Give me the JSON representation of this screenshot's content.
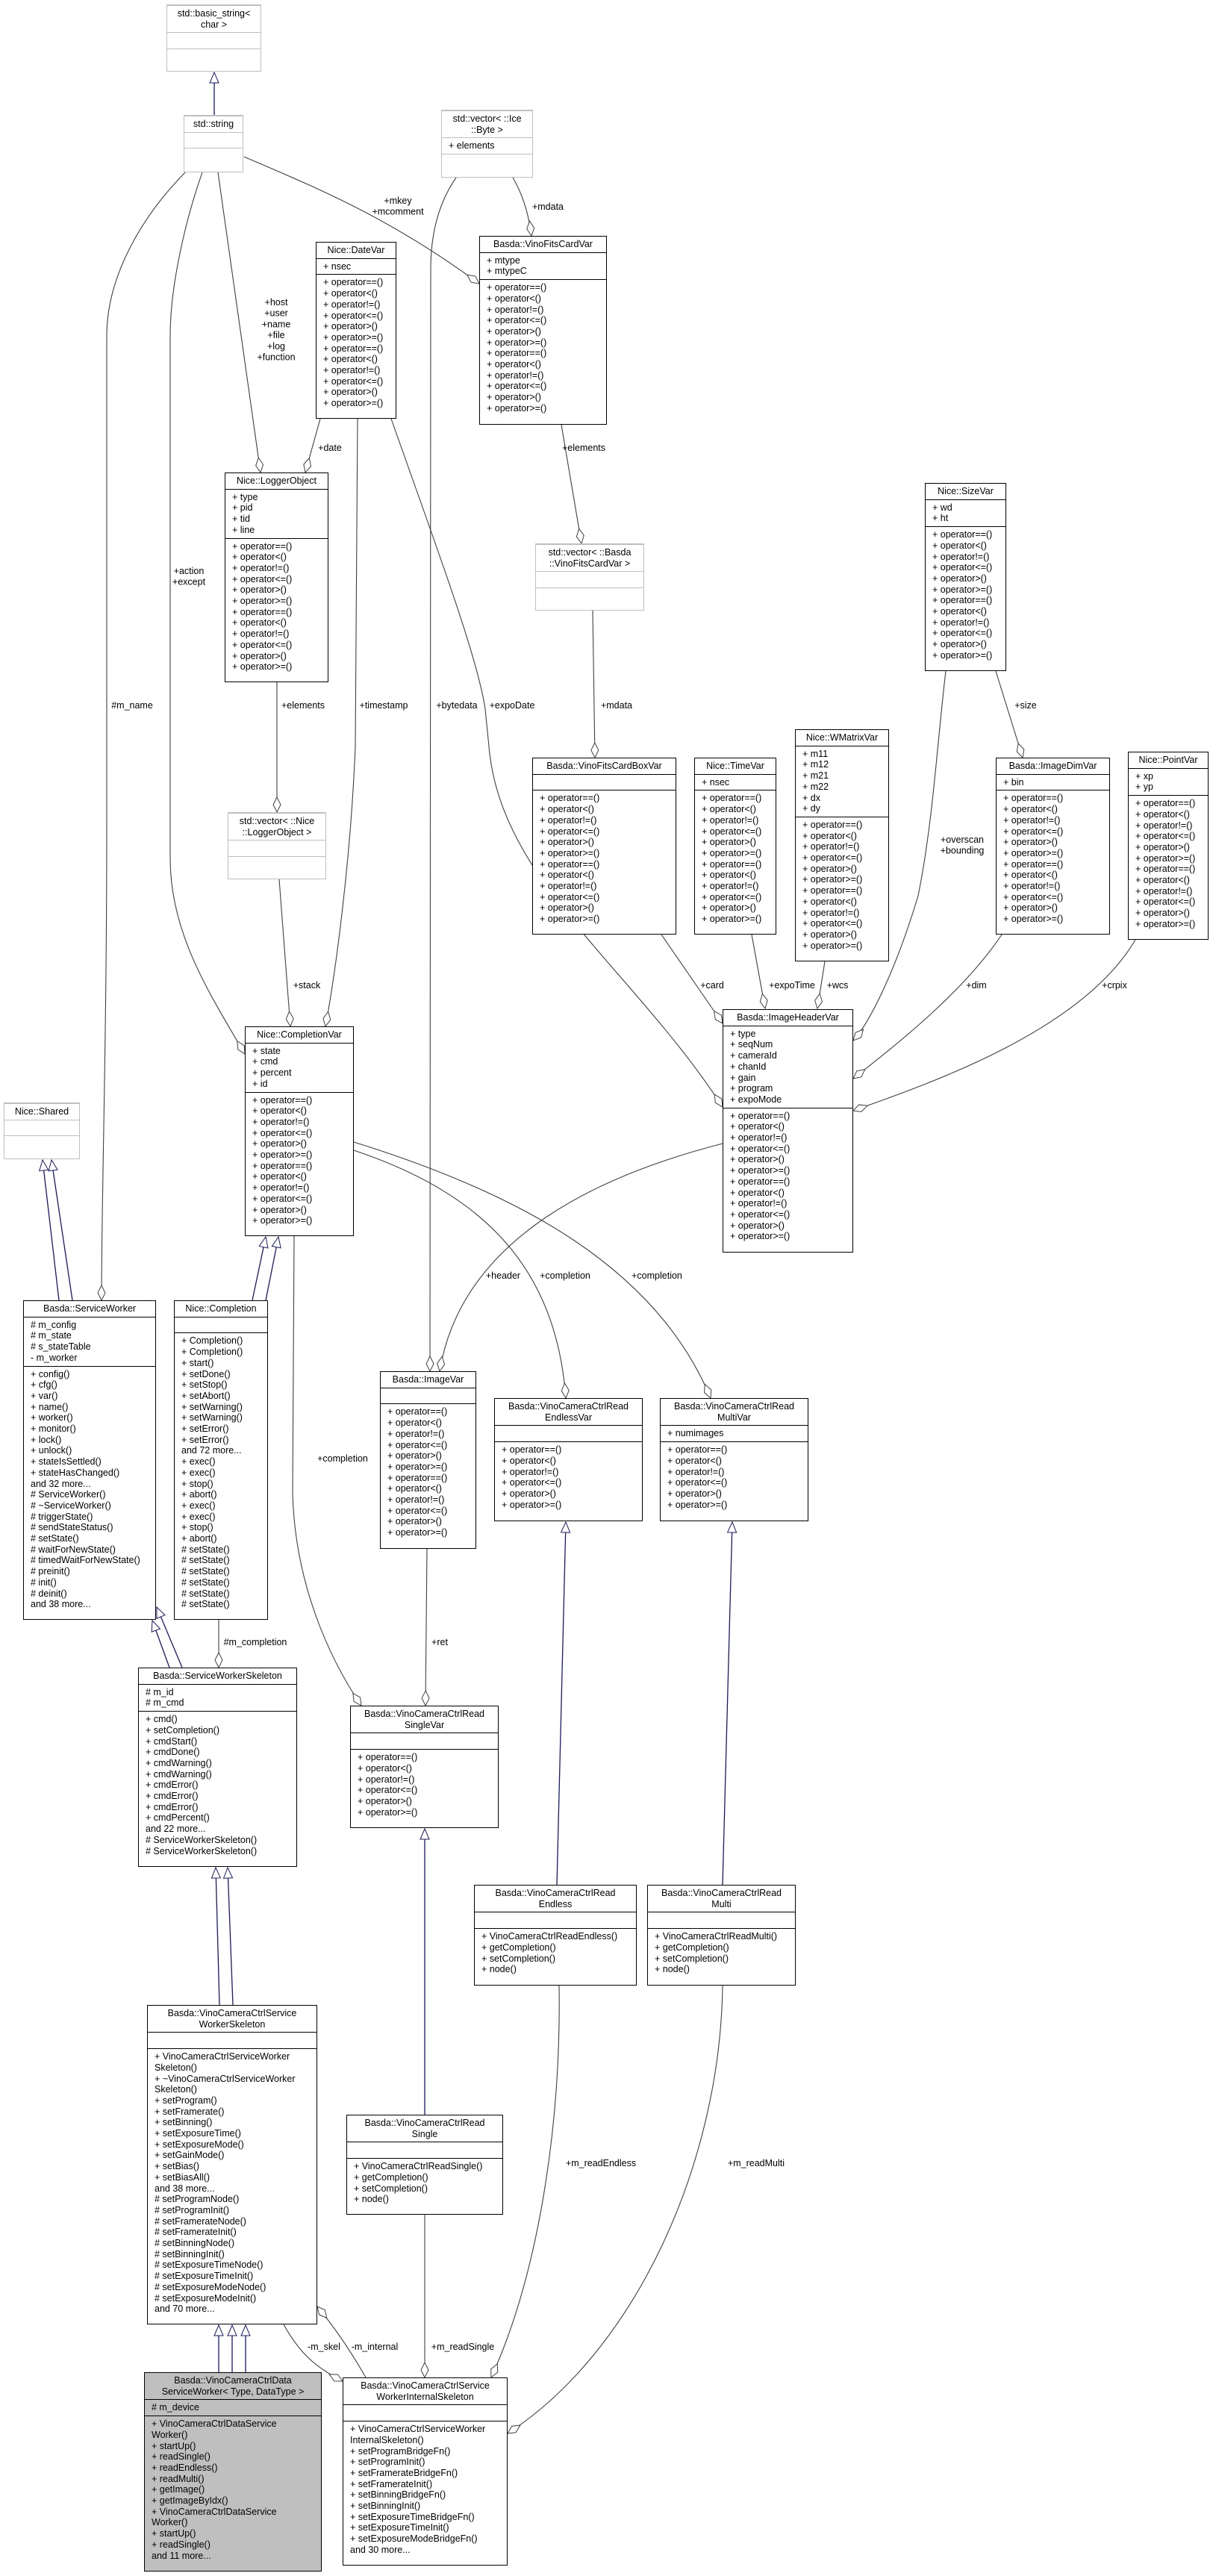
{
  "colors": {
    "inheritance": "#191970",
    "association": "#404040",
    "focus_fill": "#bfbfbf",
    "external_border": "#bfbfbf"
  },
  "classes": [
    {
      "id": "basic_string",
      "title": [
        "std::basic_string<",
        "char >"
      ],
      "attrs": [],
      "methods": [],
      "external": true
    },
    {
      "id": "string",
      "title": [
        "std::string"
      ],
      "attrs": [],
      "methods": [],
      "external": true
    },
    {
      "id": "vec_byte",
      "title": [
        "std::vector< ::Ice",
        "::Byte >"
      ],
      "attrs": [
        "+ elements"
      ],
      "methods": [],
      "external": true
    },
    {
      "id": "datevar",
      "title": [
        "Nice::DateVar"
      ],
      "attrs": [
        "+ nsec"
      ],
      "methods": [
        "+ operator==()",
        "+ operator<()",
        "+ operator!=()",
        "+ operator<=()",
        "+ operator>()",
        "+ operator>=()",
        "+ operator==()",
        "+ operator<()",
        "+ operator!=()",
        "+ operator<=()",
        "+ operator>()",
        "+ operator>=()"
      ]
    },
    {
      "id": "fitscardvar",
      "title": [
        "Basda::VinoFitsCardVar"
      ],
      "attrs": [
        "+ mtype",
        "+ mtypeC"
      ],
      "methods": [
        "+ operator==()",
        "+ operator<()",
        "+ operator!=()",
        "+ operator<=()",
        "+ operator>()",
        "+ operator>=()",
        "+ operator==()",
        "+ operator<()",
        "+ operator!=()",
        "+ operator<=()",
        "+ operator>()",
        "+ operator>=()"
      ]
    },
    {
      "id": "logger",
      "title": [
        "Nice::LoggerObject"
      ],
      "attrs": [
        "+ type",
        "+ pid",
        "+ tid",
        "+ line"
      ],
      "methods": [
        "+ operator==()",
        "+ operator<()",
        "+ operator!=()",
        "+ operator<=()",
        "+ operator>()",
        "+ operator>=()",
        "+ operator==()",
        "+ operator<()",
        "+ operator!=()",
        "+ operator<=()",
        "+ operator>()",
        "+ operator>=()"
      ]
    },
    {
      "id": "vec_fits",
      "title": [
        "std::vector< ::Basda",
        "::VinoFitsCardVar >"
      ],
      "attrs": [],
      "methods": [],
      "external": true
    },
    {
      "id": "sizevar",
      "title": [
        "Nice::SizeVar"
      ],
      "attrs": [
        "+ wd",
        "+ ht"
      ],
      "methods": [
        "+ operator==()",
        "+ operator<()",
        "+ operator!=()",
        "+ operator<=()",
        "+ operator>()",
        "+ operator>=()",
        "+ operator==()",
        "+ operator<()",
        "+ operator!=()",
        "+ operator<=()",
        "+ operator>()",
        "+ operator>=()"
      ]
    },
    {
      "id": "vec_logger",
      "title": [
        "std::vector< ::Nice",
        "::LoggerObject >"
      ],
      "attrs": [],
      "methods": [],
      "external": true
    },
    {
      "id": "fitsbox",
      "title": [
        "Basda::VinoFitsCardBoxVar"
      ],
      "attrs": [],
      "methods": [
        "+ operator==()",
        "+ operator<()",
        "+ operator!=()",
        "+ operator<=()",
        "+ operator>()",
        "+ operator>=()",
        "+ operator==()",
        "+ operator<()",
        "+ operator!=()",
        "+ operator<=()",
        "+ operator>()",
        "+ operator>=()"
      ]
    },
    {
      "id": "timevar",
      "title": [
        "Nice::TimeVar"
      ],
      "attrs": [
        "+ nsec"
      ],
      "methods": [
        "+ operator==()",
        "+ operator<()",
        "+ operator!=()",
        "+ operator<=()",
        "+ operator>()",
        "+ operator>=()",
        "+ operator==()",
        "+ operator<()",
        "+ operator!=()",
        "+ operator<=()",
        "+ operator>()",
        "+ operator>=()"
      ]
    },
    {
      "id": "wmatrix",
      "title": [
        "Nice::WMatrixVar"
      ],
      "attrs": [
        "+ m11",
        "+ m12",
        "+ m21",
        "+ m22",
        "+ dx",
        "+ dy"
      ],
      "methods": [
        "+ operator==()",
        "+ operator<()",
        "+ operator!=()",
        "+ operator<=()",
        "+ operator>()",
        "+ operator>=()",
        "+ operator==()",
        "+ operator<()",
        "+ operator!=()",
        "+ operator<=()",
        "+ operator>()",
        "+ operator>=()"
      ]
    },
    {
      "id": "imagedim",
      "title": [
        "Basda::ImageDimVar"
      ],
      "attrs": [
        "+ bin"
      ],
      "methods": [
        "+ operator==()",
        "+ operator<()",
        "+ operator!=()",
        "+ operator<=()",
        "+ operator>()",
        "+ operator>=()",
        "+ operator==()",
        "+ operator<()",
        "+ operator!=()",
        "+ operator<=()",
        "+ operator>()",
        "+ operator>=()"
      ]
    },
    {
      "id": "pointvar",
      "title": [
        "Nice::PointVar"
      ],
      "attrs": [
        "+ xp",
        "+ yp"
      ],
      "methods": [
        "+ operator==()",
        "+ operator<()",
        "+ operator!=()",
        "+ operator<=()",
        "+ operator>()",
        "+ operator>=()",
        "+ operator==()",
        "+ operator<()",
        "+ operator!=()",
        "+ operator<=()",
        "+ operator>()",
        "+ operator>=()"
      ]
    },
    {
      "id": "ihv",
      "title": [
        "Basda::ImageHeaderVar"
      ],
      "attrs": [
        "+ type",
        "+ seqNum",
        "+ cameraId",
        "+ chanId",
        "+ gain",
        "+ program",
        "+ expoMode"
      ],
      "methods": [
        "+ operator==()",
        "+ operator<()",
        "+ operator!=()",
        "+ operator<=()",
        "+ operator>()",
        "+ operator>=()",
        "+ operator==()",
        "+ operator<()",
        "+ operator!=()",
        "+ operator<=()",
        "+ operator>()",
        "+ operator>=()"
      ]
    },
    {
      "id": "completionvar",
      "title": [
        "Nice::CompletionVar"
      ],
      "attrs": [
        "+ state",
        "+ cmd",
        "+ percent",
        "+ id"
      ],
      "methods": [
        "+ operator==()",
        "+ operator<()",
        "+ operator!=()",
        "+ operator<=()",
        "+ operator>()",
        "+ operator>=()",
        "+ operator==()",
        "+ operator<()",
        "+ operator!=()",
        "+ operator<=()",
        "+ operator>()",
        "+ operator>=()"
      ]
    },
    {
      "id": "shared",
      "title": [
        "Nice::Shared"
      ],
      "attrs": [],
      "methods": [],
      "external": true
    },
    {
      "id": "serviceworker",
      "title": [
        "Basda::ServiceWorker"
      ],
      "attrs": [
        "# m_config",
        "# m_state",
        "# s_stateTable",
        "- m_worker"
      ],
      "methods": [
        "+ config()",
        "+ cfg()",
        "+ var()",
        "+ name()",
        "+ worker()",
        "+ monitor()",
        "+ lock()",
        "+ unlock()",
        "+ stateIsSettled()",
        "+ stateHasChanged()",
        "and 32 more...",
        "# ServiceWorker()",
        "# ~ServiceWorker()",
        "# triggerState()",
        "# sendStateStatus()",
        "# setState()",
        "# waitForNewState()",
        "# timedWaitForNewState()",
        "# preinit()",
        "# init()",
        "# deinit()",
        "and 38 more..."
      ]
    },
    {
      "id": "completion",
      "title": [
        "Nice::Completion"
      ],
      "attrs": [],
      "methods": [
        "+ Completion()",
        "+ Completion()",
        "+ start()",
        "+ setDone()",
        "+ setStop()",
        "+ setAbort()",
        "+ setWarning()",
        "+ setWarning()",
        "+ setError()",
        "+ setError()",
        "and 72 more...",
        "+ exec()",
        "+ exec()",
        "+ stop()",
        "+ abort()",
        "+ exec()",
        "+ exec()",
        "+ stop()",
        "+ abort()",
        "# setState()",
        "# setState()",
        "# setState()",
        "# setState()",
        "# setState()",
        "# setState()"
      ]
    },
    {
      "id": "imagevar",
      "title": [
        "Basda::ImageVar"
      ],
      "attrs": [],
      "methods": [
        "+ operator==()",
        "+ operator<()",
        "+ operator!=()",
        "+ operator<=()",
        "+ operator>()",
        "+ operator>=()",
        "+ operator==()",
        "+ operator<()",
        "+ operator!=()",
        "+ operator<=()",
        "+ operator>()",
        "+ operator>=()"
      ]
    },
    {
      "id": "endlessvar",
      "title": [
        "Basda::VinoCameraCtrlRead",
        "EndlessVar"
      ],
      "attrs": [],
      "methods": [
        "+ operator==()",
        "+ operator<()",
        "+ operator!=()",
        "+ operator<=()",
        "+ operator>()",
        "+ operator>=()"
      ]
    },
    {
      "id": "multivar",
      "title": [
        "Basda::VinoCameraCtrlRead",
        "MultiVar"
      ],
      "attrs": [
        "+ numimages"
      ],
      "methods": [
        "+ operator==()",
        "+ operator<()",
        "+ operator!=()",
        "+ operator<=()",
        "+ operator>()",
        "+ operator>=()"
      ]
    },
    {
      "id": "swskeleton",
      "title": [
        "Basda::ServiceWorkerSkeleton"
      ],
      "attrs": [
        "# m_id",
        "# m_cmd"
      ],
      "methods": [
        "+ cmd()",
        "+ setCompletion()",
        "+ cmdStart()",
        "+ cmdDone()",
        "+ cmdWarning()",
        "+ cmdWarning()",
        "+ cmdError()",
        "+ cmdError()",
        "+ cmdError()",
        "+ cmdPercent()",
        "and 22 more...",
        "# ServiceWorkerSkeleton()",
        "# ServiceWorkerSkeleton()"
      ]
    },
    {
      "id": "singlevar",
      "title": [
        "Basda::VinoCameraCtrlRead",
        "SingleVar"
      ],
      "attrs": [],
      "methods": [
        "+ operator==()",
        "+ operator<()",
        "+ operator!=()",
        "+ operator<=()",
        "+ operator>()",
        "+ operator>=()"
      ]
    },
    {
      "id": "readendless",
      "title": [
        "Basda::VinoCameraCtrlRead",
        "Endless"
      ],
      "attrs": [],
      "methods": [
        "+ VinoCameraCtrlReadEndless()",
        "+ getCompletion()",
        "+ setCompletion()",
        "+ node()"
      ]
    },
    {
      "id": "readmulti",
      "title": [
        "Basda::VinoCameraCtrlRead",
        "Multi"
      ],
      "attrs": [],
      "methods": [
        "+ VinoCameraCtrlReadMulti()",
        "+ getCompletion()",
        "+ setCompletion()",
        "+ node()"
      ]
    },
    {
      "id": "vccsws",
      "title": [
        "Basda::VinoCameraCtrlService",
        "WorkerSkeleton"
      ],
      "attrs": [],
      "methods": [
        "+ VinoCameraCtrlServiceWorker",
        "Skeleton()",
        "+ ~VinoCameraCtrlServiceWorker",
        "Skeleton()",
        "+ setProgram()",
        "+ setFramerate()",
        "+ setBinning()",
        "+ setExposureTime()",
        "+ setExposureMode()",
        "+ setGainMode()",
        "+ setBias()",
        "+ setBiasAll()",
        "and 38 more...",
        "# setProgramNode()",
        "# setProgramInit()",
        "# setFramerateNode()",
        "# setFramerateInit()",
        "# setBinningNode()",
        "# setBinningInit()",
        "# setExposureTimeNode()",
        "# setExposureTimeInit()",
        "# setExposureModeNode()",
        "# setExposureModeInit()",
        "and 70 more..."
      ]
    },
    {
      "id": "readsingle",
      "title": [
        "Basda::VinoCameraCtrlRead",
        "Single"
      ],
      "attrs": [],
      "methods": [
        "+ VinoCameraCtrlReadSingle()",
        "+ getCompletion()",
        "+ setCompletion()",
        "+ node()"
      ]
    },
    {
      "id": "dataworker",
      "title": [
        "Basda::VinoCameraCtrlData",
        "ServiceWorker< Type, DataType >"
      ],
      "attrs": [
        "# m_device"
      ],
      "methods": [
        "+ VinoCameraCtrlDataService",
        "Worker()",
        "+ startUp()",
        "+ readSingle()",
        "+ readEndless()",
        "+ readMulti()",
        "+ getImage()",
        "+ getImageByIdx()",
        "+ VinoCameraCtrlDataService",
        "Worker()",
        "+ startUp()",
        "+ readSingle()",
        "and 11 more..."
      ],
      "focus": true
    },
    {
      "id": "internal",
      "title": [
        "Basda::VinoCameraCtrlService",
        "WorkerInternalSkeleton"
      ],
      "attrs": [],
      "methods": [
        "+ VinoCameraCtrlServiceWorker",
        "InternalSkeleton()",
        "+ setProgramBridgeFn()",
        "+ setProgramInit()",
        "+ setFramerateBridgeFn()",
        "+ setFramerateInit()",
        "+ setBinningBridgeFn()",
        "+ setBinningInit()",
        "+ setExposureTimeBridgeFn()",
        "+ setExposureTimeInit()",
        "+ setExposureModeBridgeFn()",
        "and 30 more..."
      ]
    }
  ],
  "inheritance": [
    {
      "child": "string",
      "parent": "basic_string"
    },
    {
      "child": "serviceworker",
      "parent": "shared"
    },
    {
      "child": "serviceworker",
      "parent": "shared"
    },
    {
      "child": "completion",
      "parent": "completionvar"
    },
    {
      "child": "completion",
      "parent": "completionvar"
    },
    {
      "child": "swskeleton",
      "parent": "serviceworker"
    },
    {
      "child": "swskeleton",
      "parent": "serviceworker"
    },
    {
      "child": "vccsws",
      "parent": "swskeleton"
    },
    {
      "child": "vccsws",
      "parent": "swskeleton"
    },
    {
      "child": "dataworker",
      "parent": "vccsws"
    },
    {
      "child": "dataworker",
      "parent": "vccsws"
    },
    {
      "child": "dataworker",
      "parent": "vccsws"
    },
    {
      "child": "readsingle",
      "parent": "singlevar"
    },
    {
      "child": "readendless",
      "parent": "endlessvar"
    },
    {
      "child": "readmulti",
      "parent": "multivar"
    }
  ],
  "associations": [
    {
      "from": "string",
      "to": "fitscardvar",
      "label": [
        "+mkey",
        "+mcomment"
      ]
    },
    {
      "from": "vec_byte",
      "to": "fitscardvar",
      "label": [
        "+mdata"
      ]
    },
    {
      "from": "vec_byte",
      "to": "imagevar",
      "label": [
        "+bytedata"
      ]
    },
    {
      "from": "string",
      "to": "logger",
      "label": [
        "+host",
        "+user",
        "+name",
        "+file",
        "+log",
        "+function"
      ]
    },
    {
      "from": "datevar",
      "to": "logger",
      "label": [
        "+date"
      ]
    },
    {
      "from": "string",
      "to": "completionvar",
      "label": [
        "+action",
        "+except"
      ]
    },
    {
      "from": "string",
      "to": "serviceworker",
      "label": [
        "#m_name"
      ]
    },
    {
      "from": "logger",
      "to": "vec_logger",
      "label": [
        "+elements"
      ]
    },
    {
      "from": "vec_logger",
      "to": "completionvar",
      "label": [
        "+stack"
      ]
    },
    {
      "from": "datevar",
      "to": "completionvar",
      "label": [
        "+timestamp"
      ]
    },
    {
      "from": "datevar",
      "to": "ihv",
      "label": [
        "+expoDate"
      ]
    },
    {
      "from": "fitscardvar",
      "to": "vec_fits",
      "label": [
        "+elements"
      ]
    },
    {
      "from": "vec_fits",
      "to": "fitsbox",
      "label": [
        "+mdata"
      ]
    },
    {
      "from": "fitsbox",
      "to": "ihv",
      "label": [
        "+card"
      ]
    },
    {
      "from": "timevar",
      "to": "ihv",
      "label": [
        "+expoTime"
      ]
    },
    {
      "from": "wmatrix",
      "to": "ihv",
      "label": [
        "+wcs"
      ]
    },
    {
      "from": "sizevar",
      "to": "ihv",
      "label": [
        "+overscan",
        "+bounding"
      ]
    },
    {
      "from": "sizevar",
      "to": "imagedim",
      "label": [
        "+size"
      ]
    },
    {
      "from": "imagedim",
      "to": "ihv",
      "label": [
        "+dim"
      ]
    },
    {
      "from": "pointvar",
      "to": "ihv",
      "label": [
        "+crpix"
      ]
    },
    {
      "from": "ihv",
      "to": "imagevar",
      "label": [
        "+header"
      ]
    },
    {
      "from": "completionvar",
      "to": "endlessvar",
      "label": [
        "+completion"
      ]
    },
    {
      "from": "completionvar",
      "to": "multivar",
      "label": [
        "+completion"
      ]
    },
    {
      "from": "completionvar",
      "to": "singlevar",
      "label": [
        "+completion"
      ]
    },
    {
      "from": "imagevar",
      "to": "singlevar",
      "label": [
        "+ret"
      ]
    },
    {
      "from": "completion",
      "to": "swskeleton",
      "label": [
        "#m_completion"
      ]
    },
    {
      "from": "vccsws",
      "to": "internal",
      "label": [
        "-m_skel"
      ]
    },
    {
      "from": "internal",
      "to": "vccsws",
      "label": [
        "-m_internal"
      ]
    },
    {
      "from": "readsingle",
      "to": "internal",
      "label": [
        "+m_readSingle"
      ]
    },
    {
      "from": "readendless",
      "to": "internal",
      "label": [
        "+m_readEndless"
      ]
    },
    {
      "from": "readmulti",
      "to": "internal",
      "label": [
        "+m_readMulti"
      ]
    }
  ]
}
